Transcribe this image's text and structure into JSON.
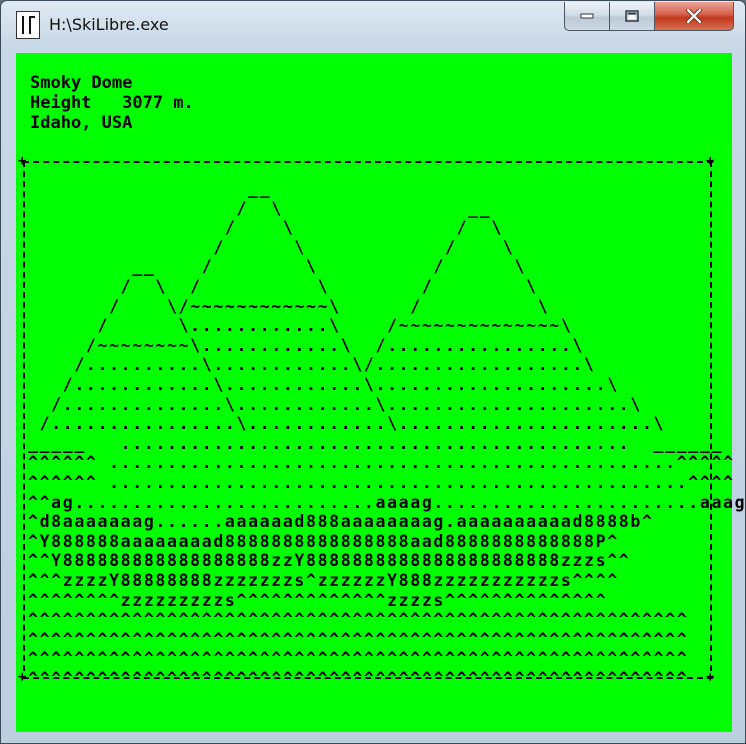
{
  "window": {
    "title": "H:\\SkiLibre.exe",
    "controls": {
      "minimize": "minimize",
      "maximize": "maximize",
      "close": "close"
    }
  },
  "header": {
    "line1": "Smoky Dome",
    "line2": "Height   3077 m.",
    "line3": "Idaho, USA"
  },
  "art_rows": [
    "                   __",
    "                  /  \\                __",
    "                 /    \\              /  \\",
    "                /      \\            /    \\",
    "         __    /        \\          /      \\",
    "        /  \\  /          \\        /        \\",
    "       /    \\/~~~~~~~~~~~~\\      /          \\",
    "      /      \\............\\    /~~~~~~~~~~~~~~\\",
    "     /~~~~~~~~\\............\\  /................\\",
    "    /..........\\............\\/..................\\",
    "   /............\\............\\....................\\",
    "  /..............\\............\\.....................\\",
    " /................\\............\\......................\\",
    "_____   ............................................  ______",
    "^^^^^^ .................................................^^^^^",
    "^^^^^^ ..................................................^^^^",
    "^^ag..........................aaaag.......................aaag^^",
    "^d8aaaaaaag......aaaaaad888aaaaaaaag.aaaaaaaaaad8888b^",
    "^Y888888aaaaaaaad8888888888888888aad8888888888888P^",
    "^^Y888888888888888888zzY8888888888888888888888zzzs^^",
    "^^^zzzzY88888888zzzzzzzs^zzzzzzY888zzzzzzzzzzzs^^^^",
    "^^^^^^^^zzzzzzzzzs^^^^^^^^^^^^^zzzzs^^^^^^^^^^^^^^",
    "^^^^^^^^^^^^^^^^^^^^^^^^^^^^^^^^^^^^^^^^^^^^^^^^^^^^^^^^^",
    "^^^^^^^^^^^^^^^^^^^^^^^^^^^^^^^^^^^^^^^^^^^^^^^^^^^^^^^^^",
    "^^^^^^^^^^^^^^^^^^^^^^^^^^^^^^^^^^^^^^^^^^^^^^^^^^^^^^^^^",
    "^^^^^^^^^^^^^^^^^^^^^^^^^^^^^^^^^^^^^^^^^^^^^^^^^^^^^^^^^"
  ],
  "colors": {
    "background": "#00ff00",
    "text": "#000000",
    "close_button": "#c3391f"
  },
  "icons": {
    "app": "app-icon",
    "minimize": "minimize-icon",
    "maximize": "maximize-icon",
    "close": "close-icon"
  }
}
